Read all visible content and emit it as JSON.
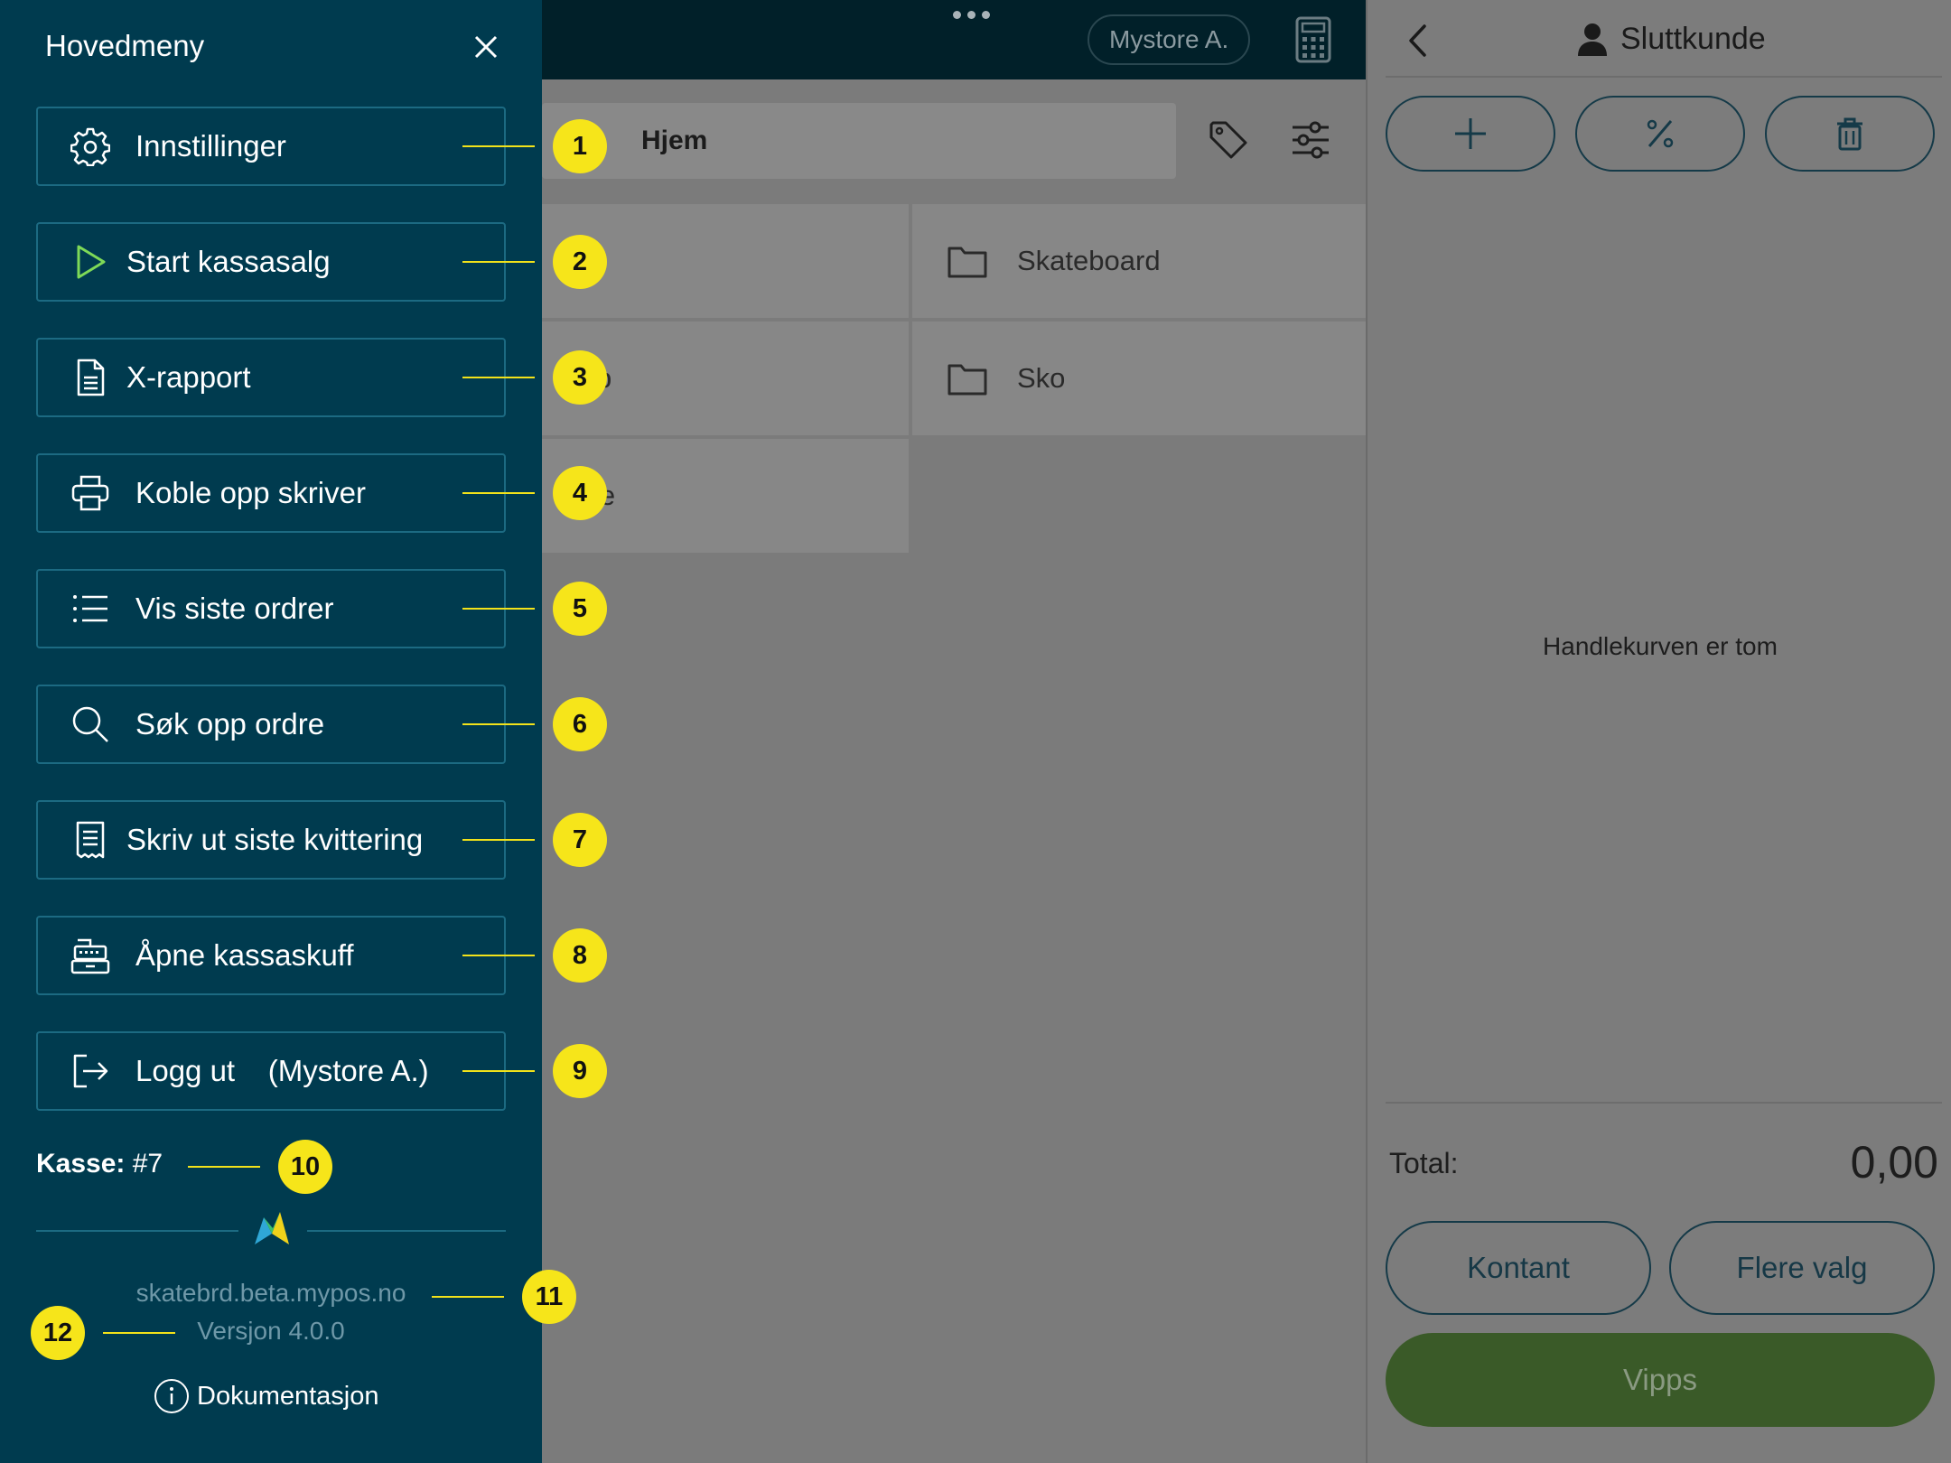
{
  "topbar": {
    "user": "Mystore A."
  },
  "main": {
    "breadcrumb": "Hjem",
    "tiles": [
      {
        "label": "Skateboard"
      },
      {
        "label": "Sko"
      },
      {
        "label": "rse"
      }
    ],
    "partial_labels": [
      "p"
    ]
  },
  "cart": {
    "customer": "Sluttkunde",
    "empty_message": "Handlekurven er tom",
    "total_label": "Total:",
    "total_value": "0,00",
    "cash_label": "Kontant",
    "more_label": "Flere valg",
    "vipps_label": "Vipps"
  },
  "drawer": {
    "title": "Hovedmeny",
    "items": [
      {
        "label": "Innstillinger",
        "icon": "gear-icon"
      },
      {
        "label": "Start kassasalg",
        "icon": "play-icon"
      },
      {
        "label": "X-rapport",
        "icon": "document-icon"
      },
      {
        "label": "Koble opp skriver",
        "icon": "printer-icon"
      },
      {
        "label": "Vis siste ordrer",
        "icon": "list-icon"
      },
      {
        "label": "Søk opp ordre",
        "icon": "search-icon"
      },
      {
        "label": "Skriv ut siste kvittering",
        "icon": "receipt-icon"
      },
      {
        "label": "Åpne kassaskuff",
        "icon": "cash-drawer-icon"
      },
      {
        "label": "Logg ut    (Mystore A.)",
        "icon": "logout-icon"
      }
    ],
    "register_label": "Kasse:",
    "register_value": "#7",
    "domain": "skatebrd.beta.mypos.no",
    "version": "Versjon 4.0.0",
    "docs_label": "Dokumentasjon"
  },
  "callouts": [
    "1",
    "2",
    "3",
    "4",
    "5",
    "6",
    "7",
    "8",
    "9",
    "10",
    "11",
    "12"
  ],
  "colors": {
    "drawer_bg": "#003b4f",
    "badge": "#f6e51a",
    "play_accent": "#7ed957",
    "vipps": "#3a5a28"
  }
}
